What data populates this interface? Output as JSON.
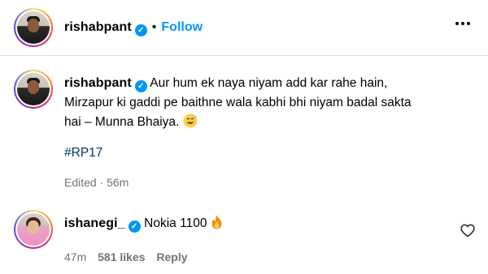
{
  "post_header": {
    "username": "rishabpant",
    "separator": "•",
    "follow_label": "Follow"
  },
  "caption": {
    "username": "rishabpant",
    "text_line1": "Aur hum ek naya niyam add kar rahe hain,",
    "text_line2": "Mirzapur ki gaddi pe baithne wala kabhi bhi niyam badal sakta",
    "text_line3": "hai – Munna Bhaiya.",
    "hashtag": "#RP17",
    "meta": "Edited · 56m"
  },
  "comment": {
    "username": "ishanegi_",
    "text": "Nokia 1100",
    "time": "47m",
    "likes": "581 likes",
    "reply_label": "Reply"
  },
  "colors": {
    "accent": "#0095f6",
    "hashtag": "#00376b",
    "secondary_text": "#737373",
    "divider": "#dbdbdb"
  },
  "icons": {
    "verified": "verified-badge-icon",
    "more": "more-options-icon",
    "emoji_caption": "grinning-sweat-emoji",
    "emoji_comment": "fire-emoji",
    "like": "heart-outline-icon"
  }
}
